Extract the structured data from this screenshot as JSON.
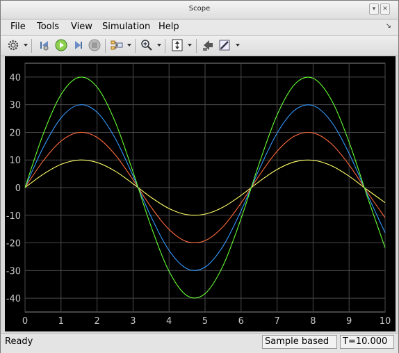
{
  "window": {
    "title": "Scope"
  },
  "menu": {
    "items": [
      {
        "label": "File",
        "name": "menu-file"
      },
      {
        "label": "Tools",
        "name": "menu-tools"
      },
      {
        "label": "View",
        "name": "menu-view"
      },
      {
        "label": "Simulation",
        "name": "menu-simulation"
      },
      {
        "label": "Help",
        "name": "menu-help"
      }
    ]
  },
  "toolbar": {
    "icons": [
      "gear-icon",
      "step-back-icon",
      "run-icon",
      "step-forward-icon",
      "stop-icon",
      "signal-selector-icon",
      "zoom-in-icon",
      "autoscale-icon",
      "highlight-simulink-block-icon",
      "style-icon"
    ]
  },
  "status": {
    "ready": "Ready",
    "mode": "Sample based",
    "time": "T=10.000"
  },
  "colors": {
    "background": "#000000",
    "grid": "#4a4a4a",
    "axis_text": "#c8c8c8"
  },
  "chart_data": {
    "type": "line",
    "title": "",
    "xlabel": "",
    "ylabel": "",
    "xlim": [
      0,
      10
    ],
    "ylim": [
      -45,
      45
    ],
    "xticks": [
      0,
      1,
      2,
      3,
      4,
      5,
      6,
      7,
      8,
      9,
      10
    ],
    "yticks": [
      -40,
      -30,
      -20,
      -10,
      0,
      10,
      20,
      30,
      40
    ],
    "grid": true,
    "x": [
      0,
      0.5,
      1,
      1.5,
      2,
      2.5,
      3,
      3.5,
      4,
      4.5,
      5,
      5.5,
      6,
      6.5,
      7,
      7.5,
      8,
      8.5,
      9,
      9.5,
      10
    ],
    "series": [
      {
        "color": "#ffff66",
        "values": [
          0,
          4.79,
          8.41,
          9.97,
          9.09,
          5.98,
          1.41,
          -3.51,
          -7.57,
          -9.78,
          -9.59,
          -7.06,
          -2.79,
          2.15,
          6.57,
          9.38,
          9.89,
          7.98,
          4.12,
          -0.75,
          -5.44
        ]
      },
      {
        "color": "#ff6a3d",
        "values": [
          0,
          9.59,
          16.83,
          19.95,
          18.19,
          11.97,
          2.82,
          -7.02,
          -15.14,
          -19.55,
          -19.18,
          -14.11,
          -5.59,
          4.3,
          13.14,
          18.76,
          19.79,
          15.96,
          8.24,
          -1.5,
          -10.88
        ]
      },
      {
        "color": "#3399ff",
        "values": [
          0,
          14.38,
          25.24,
          29.92,
          27.28,
          17.95,
          4.23,
          -10.52,
          -22.7,
          -29.33,
          -28.77,
          -21.17,
          -8.38,
          6.45,
          19.71,
          28.14,
          29.68,
          23.94,
          12.36,
          -2.25,
          -16.32
        ]
      },
      {
        "color": "#66ff33",
        "values": [
          0,
          19.18,
          33.66,
          39.9,
          36.37,
          23.94,
          5.64,
          -14.03,
          -30.27,
          -39.1,
          -38.36,
          -28.23,
          -11.18,
          8.6,
          26.28,
          37.52,
          39.57,
          31.92,
          16.48,
          -3.0,
          -21.76
        ]
      }
    ]
  }
}
